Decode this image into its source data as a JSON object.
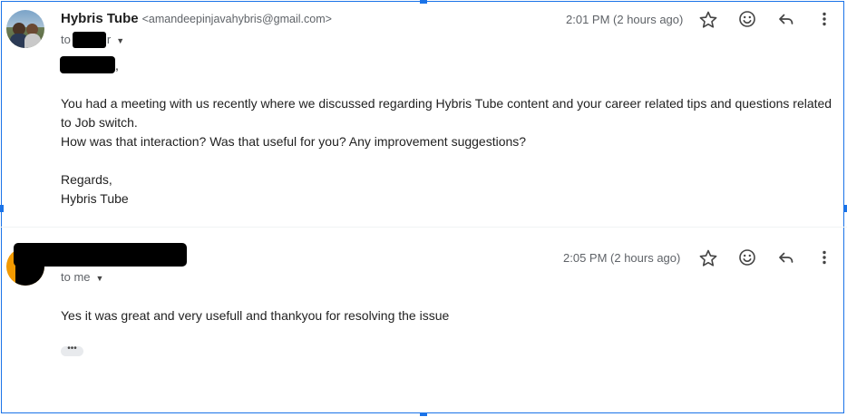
{
  "message1": {
    "sender_name": "Hybris Tube",
    "sender_email": "<amandeepinjavahybris@gmail.com>",
    "recipient": "to",
    "recipient_suffix": "r",
    "time": "2:01 PM (2 hours ago)",
    "greeting_suffix": ",",
    "paragraph1": "You had a meeting with us recently where we discussed regarding Hybris Tube content and your career related tips and questions related to Job switch.",
    "paragraph2": "How was that interaction? Was that useful for you? Any improvement suggestions?",
    "regards": "Regards,",
    "signature": "Hybris Tube"
  },
  "message2": {
    "recipient": "to me",
    "time": "2:05 PM (2 hours ago)",
    "body": "Yes it was great and very usefull and thankyou for resolving the issue",
    "ellipsis": "•••"
  },
  "icons": [
    "star-icon",
    "emoji-icon",
    "reply-icon",
    "more-vert-icon",
    "chevron-down-icon"
  ],
  "colors": {
    "selection": "#1a73e8",
    "secondary_text": "#5f6368",
    "avatar2_bg": "#f29900"
  }
}
